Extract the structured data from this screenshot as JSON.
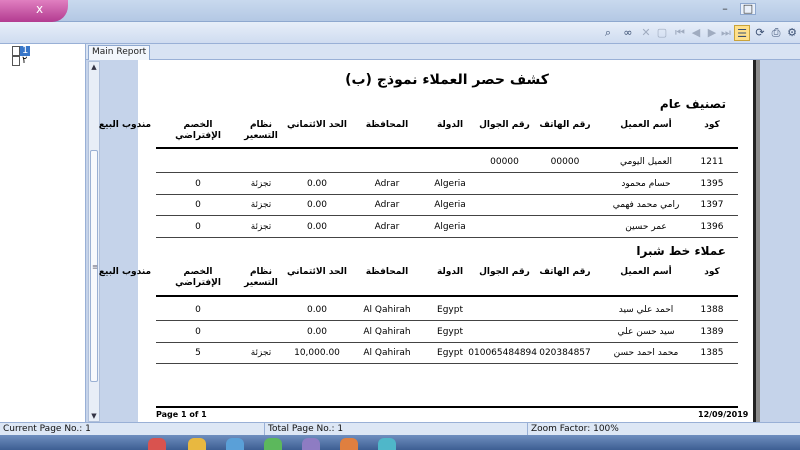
{
  "window": {
    "title_glyph": "x",
    "title_text": "",
    "minimize_glyph": "–",
    "maximize_glyph": "□"
  },
  "toolbar": {
    "icons": [
      "find-icon",
      "binoculars-icon",
      "stop-icon",
      "export-icon",
      "first-page-icon",
      "prev-page-icon",
      "next-page-icon",
      "last-page-icon",
      "tree-toggle-icon",
      "refresh-icon",
      "print-icon",
      "page-setup-icon"
    ]
  },
  "tree": {
    "nodes": [
      {
        "label": "1",
        "selected": true
      },
      {
        "label": "٢",
        "selected": false
      }
    ]
  },
  "tabs": {
    "main_report": "Main Report"
  },
  "report": {
    "title": "كشف حصر العملاء نموذج (ب)",
    "headers": {
      "code": "كود",
      "customer_name": "أسم العميل",
      "phone": "رقم الهاتف",
      "mobile": "رقم الجوال",
      "country": "الدولة",
      "governorate": "المحافظة",
      "credit_limit": "الحد الائتماني",
      "pricing_system": "نظام التسعير",
      "default_discount": "الخصم الإفتراضي",
      "sales_rep": "مندوب البيع"
    },
    "sections": [
      {
        "title": "تصنيف عام",
        "rows": [
          {
            "code": "1211",
            "customer_name": "العميل اليومي",
            "phone": "00000",
            "mobile": "00000",
            "country": "",
            "governorate": "",
            "credit_limit": "",
            "pricing_system": "",
            "default_discount": "",
            "sales_rep": ""
          },
          {
            "code": "1395",
            "customer_name": "حسام محمود",
            "phone": "",
            "mobile": "",
            "country": "Algeria",
            "governorate": "Adrar",
            "credit_limit": "0.00",
            "pricing_system": "تجزئة",
            "default_discount": "0",
            "sales_rep": ""
          },
          {
            "code": "1397",
            "customer_name": "رامي محمد فهمي",
            "phone": "",
            "mobile": "",
            "country": "Algeria",
            "governorate": "Adrar",
            "credit_limit": "0.00",
            "pricing_system": "تجزئة",
            "default_discount": "0",
            "sales_rep": ""
          },
          {
            "code": "1396",
            "customer_name": "عمر حسين",
            "phone": "",
            "mobile": "",
            "country": "Algeria",
            "governorate": "Adrar",
            "credit_limit": "0.00",
            "pricing_system": "تجزئة",
            "default_discount": "0",
            "sales_rep": ""
          }
        ]
      },
      {
        "title": "عملاء خط شبرا",
        "rows": [
          {
            "code": "1388",
            "customer_name": "احمد علي سيد",
            "phone": "",
            "mobile": "",
            "country": "Egypt",
            "governorate": "Al Qahirah",
            "credit_limit": "0.00",
            "pricing_system": "",
            "default_discount": "0",
            "sales_rep": ""
          },
          {
            "code": "1389",
            "customer_name": "سيد حسن علي",
            "phone": "",
            "mobile": "",
            "country": "Egypt",
            "governorate": "Al Qahirah",
            "credit_limit": "0.00",
            "pricing_system": "",
            "default_discount": "0",
            "sales_rep": ""
          },
          {
            "code": "1385",
            "customer_name": "محمد احمد حسن",
            "phone": "020384857",
            "mobile": "010065484894",
            "country": "Egypt",
            "governorate": "Al Qahirah",
            "credit_limit": "10,000.00",
            "pricing_system": "تجزئة",
            "default_discount": "5",
            "sales_rep": ""
          }
        ]
      }
    ],
    "footer": {
      "page_info": "Page 1 of 1",
      "date": "12/09/2019"
    }
  },
  "status": {
    "current_page": "Current Page No.: 1",
    "total_page": "Total Page No.: 1",
    "zoom": "Zoom Factor: 100%"
  }
}
